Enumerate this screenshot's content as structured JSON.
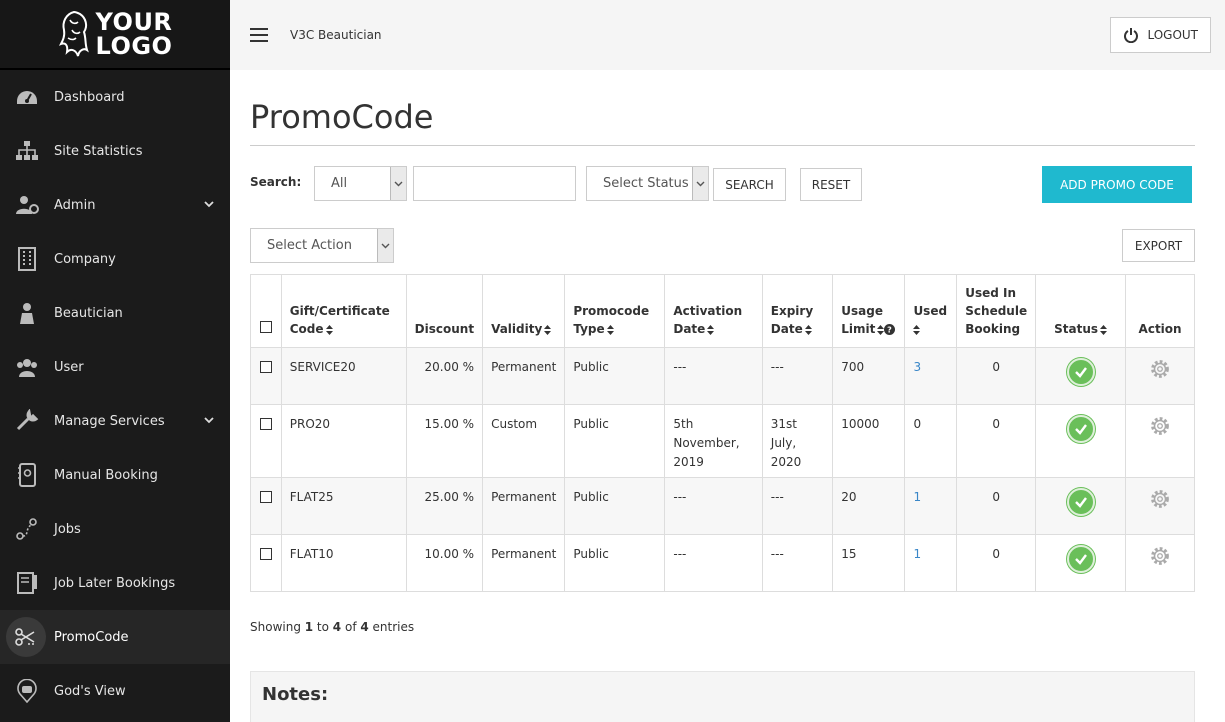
{
  "logo": {
    "line1": "YOUR",
    "line2": "LOGO"
  },
  "sidebar": {
    "items": [
      {
        "label": "Dashboard",
        "icon": "dashboard-icon"
      },
      {
        "label": "Site Statistics",
        "icon": "sitemap-icon"
      },
      {
        "label": "Admin",
        "icon": "admin-icon",
        "expandable": true
      },
      {
        "label": "Company",
        "icon": "building-icon"
      },
      {
        "label": "Beautician",
        "icon": "beautician-icon"
      },
      {
        "label": "User",
        "icon": "users-icon"
      },
      {
        "label": "Manage Services",
        "icon": "wrench-icon",
        "expandable": true
      },
      {
        "label": "Manual Booking",
        "icon": "manual-booking-icon"
      },
      {
        "label": "Jobs",
        "icon": "jobs-icon"
      },
      {
        "label": "Job Later Bookings",
        "icon": "notebook-icon"
      },
      {
        "label": "PromoCode",
        "icon": "promocode-icon",
        "active": true
      },
      {
        "label": "God's View",
        "icon": "car-pin-icon"
      }
    ]
  },
  "topbar": {
    "brand": "V3C  Beautician",
    "logout_label": "LOGOUT"
  },
  "page": {
    "title": "PromoCode"
  },
  "search": {
    "label": "Search:",
    "scope_value": "All",
    "text_value": "",
    "status_value": "Select Status",
    "search_button": "SEARCH",
    "reset_button": "RESET",
    "add_button": "ADD PROMO CODE",
    "action_value": "Select Action",
    "export_button": "EXPORT"
  },
  "table": {
    "headers": {
      "code": [
        "Gift/Certificate",
        "Code"
      ],
      "discount": "Discount",
      "validity": "Validity",
      "type": [
        "Promocode",
        "Type"
      ],
      "activation": [
        "Activation",
        "Date"
      ],
      "expiry": [
        "Expiry",
        "Date"
      ],
      "usage": [
        "Usage",
        "Limit"
      ],
      "used": "Used",
      "schedule": [
        "Used In",
        "Schedule",
        "Booking"
      ],
      "status": "Status",
      "action": "Action"
    },
    "rows": [
      {
        "code": "SERVICE20",
        "discount": "20.00 %",
        "validity": "Permanent",
        "type": "Public",
        "activation": "---",
        "expiry": "---",
        "usage": "700",
        "used": "3",
        "used_link": true,
        "schedule": "0",
        "status": "active"
      },
      {
        "code": "PRO20",
        "discount": "15.00 %",
        "validity": "Custom",
        "type": "Public",
        "activation": "5th November, 2019",
        "expiry": "31st July, 2020",
        "usage": "10000",
        "used": "0",
        "used_link": false,
        "schedule": "0",
        "status": "active"
      },
      {
        "code": "FLAT25",
        "discount": "25.00 %",
        "validity": "Permanent",
        "type": "Public",
        "activation": "---",
        "expiry": "---",
        "usage": "20",
        "used": "1",
        "used_link": true,
        "schedule": "0",
        "status": "active"
      },
      {
        "code": "FLAT10",
        "discount": "10.00 %",
        "validity": "Permanent",
        "type": "Public",
        "activation": "---",
        "expiry": "---",
        "usage": "15",
        "used": "1",
        "used_link": true,
        "schedule": "0",
        "status": "active"
      }
    ]
  },
  "footer": {
    "showing_prefix": "Showing ",
    "from": "1",
    "to_word": " to ",
    "to": "4",
    "of_word": " of ",
    "total": "4",
    "suffix": " entries"
  },
  "notes": {
    "title": "Notes:"
  },
  "colors": {
    "accent": "#1fb9cf",
    "sidebar": "#1b1b1b",
    "status_green": "#6abf5a",
    "link": "#3a87c8"
  }
}
